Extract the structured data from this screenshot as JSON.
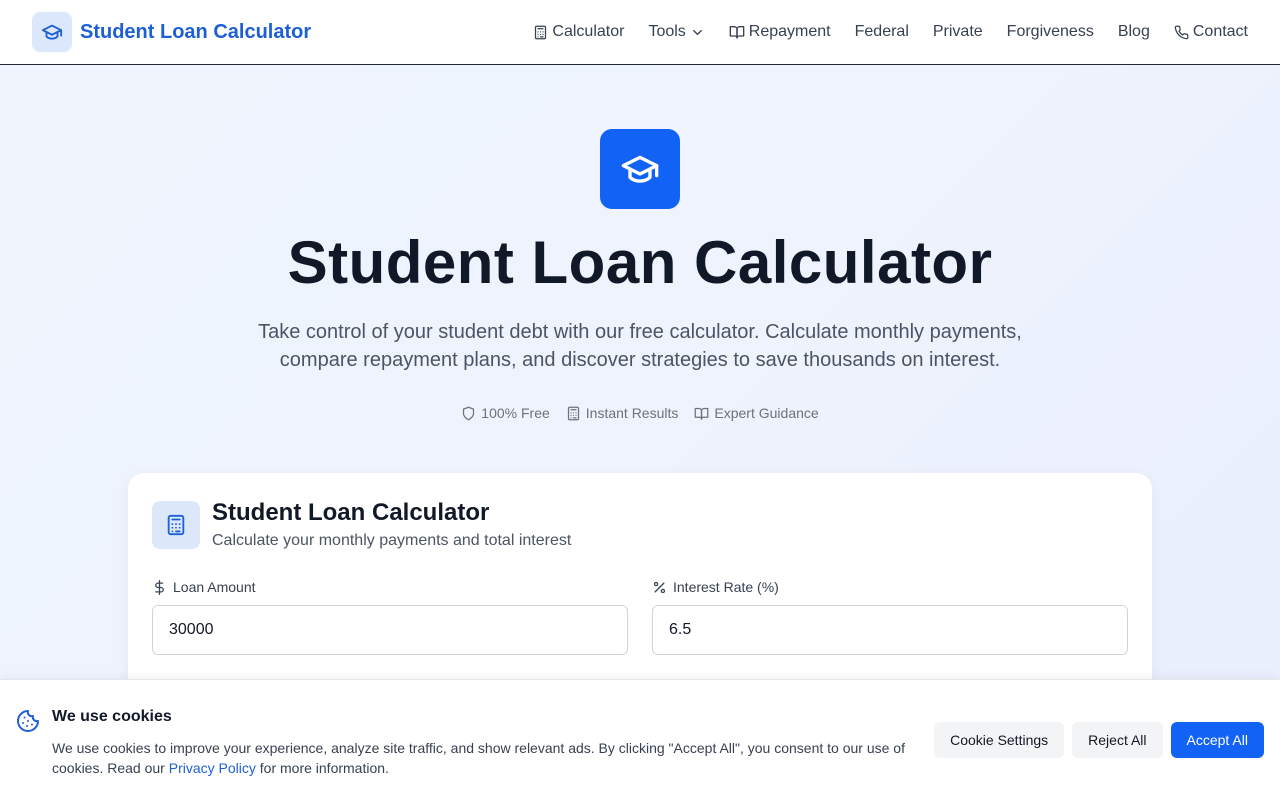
{
  "header": {
    "brand": "Student Loan Calculator",
    "nav": [
      {
        "label": "Calculator",
        "icon": "calculator-icon"
      },
      {
        "label": "Tools",
        "icon": "chevron-down-icon"
      },
      {
        "label": "Repayment",
        "icon": "book-open-icon"
      },
      {
        "label": "Federal"
      },
      {
        "label": "Private"
      },
      {
        "label": "Forgiveness"
      },
      {
        "label": "Blog"
      },
      {
        "label": "Contact",
        "icon": "phone-icon"
      }
    ]
  },
  "hero": {
    "title": "Student Loan Calculator",
    "subtitle": "Take control of your student debt with our free calculator. Calculate monthly payments, compare repayment plans, and discover strategies to save thousands on interest.",
    "badges": [
      {
        "label": "100% Free",
        "icon": "shield-icon"
      },
      {
        "label": "Instant Results",
        "icon": "calculator-icon"
      },
      {
        "label": "Expert Guidance",
        "icon": "book-open-icon"
      }
    ]
  },
  "calculator": {
    "title": "Student Loan Calculator",
    "subtitle": "Calculate your monthly payments and total interest",
    "fields": [
      {
        "label": "Loan Amount",
        "value": "30000",
        "icon": "dollar-icon"
      },
      {
        "label": "Interest Rate (%)",
        "value": "6.5",
        "icon": "percent-icon"
      }
    ]
  },
  "cookie_banner": {
    "title": "We use cookies",
    "text_before": "We use cookies to improve your experience, analyze site traffic, and show relevant ads. By clicking \"Accept All\", you consent to our use of cookies. Read our ",
    "link": "Privacy Policy",
    "text_after": " for more information.",
    "buttons": {
      "settings": "Cookie Settings",
      "reject": "Reject All",
      "accept": "Accept All"
    }
  },
  "colors": {
    "brand": "#1d5fd6",
    "primary": "#1362f6",
    "icon_bg": "#dbe7fb",
    "hero_bg": "#eef3fd"
  }
}
